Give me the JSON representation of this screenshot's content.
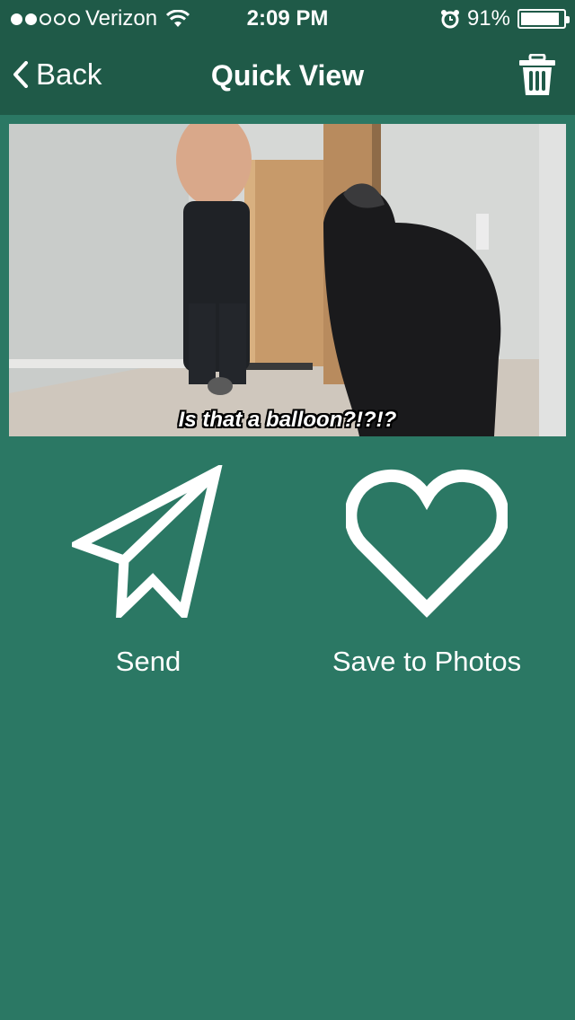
{
  "status_bar": {
    "carrier": "Verizon",
    "time": "2:09 PM",
    "battery": "91%",
    "battery_level": 0.91,
    "signal_bars_filled": 2,
    "signal_bars_total": 5,
    "icons": [
      "wifi-icon",
      "alarm-icon",
      "battery-icon"
    ]
  },
  "nav": {
    "back_label": "Back",
    "title": "Quick View",
    "back_icon": "chevron-left-icon",
    "delete_icon": "trash-icon"
  },
  "media": {
    "caption": "Is that a balloon?!?!?"
  },
  "actions": [
    {
      "label": "Send",
      "icon": "paper-plane-icon"
    },
    {
      "label": "Save to Photos",
      "icon": "heart-icon"
    }
  ],
  "colors": {
    "background": "#2b7864",
    "bar": "#1f5a48",
    "foreground": "#ffffff"
  }
}
